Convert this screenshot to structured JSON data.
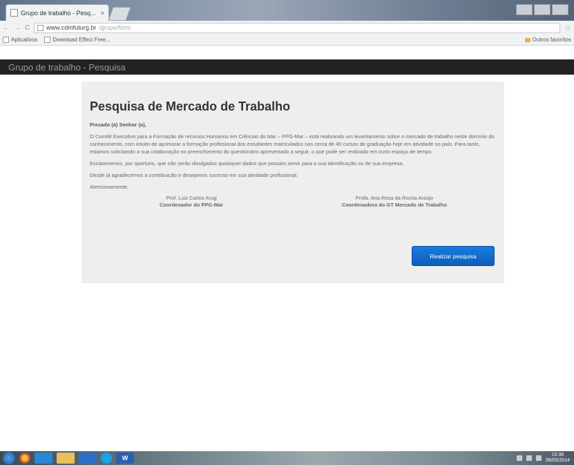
{
  "browser": {
    "tab_title": "Grupo de trabalho - Pesq...",
    "tab_close": "×",
    "url_host": "www.cdmfuturg.br",
    "url_path": "/grupo/form",
    "bookmarks": [
      "Aplicativos",
      "Download Effect Free..."
    ],
    "bookmark_right": "Outros favoritos"
  },
  "navbar": {
    "brand": "Grupo de trabalho - Pesquisa"
  },
  "main": {
    "title": "Pesquisa de Mercado de Trabalho",
    "greeting": "Prezado (a) Senhor (a),",
    "paragraph1": "O Comitê Executivo para a Formação de recursos Humanos em Ciências do Mar – PPG-Mar – está realizando um levantamento sobre o mercado de trabalho neste domínio do conhecimento, com intuito de aprimorar a formação profissional dos estudantes matriculados nos cerca de 40 cursos de graduação hoje em atividade no país. Para tanto, estamos solicitando a sua colaboração no preenchimento do questionário apresentado a seguir, o que pode ser realizado em curto espaço de tempo.",
    "paragraph2": "Esclarecemos, por oportuno, que não serão divulgados quaisquer dados que possam servir para a sua identificação ou de sua empresa.",
    "paragraph3": "Desde já agradecemos a contribuição e desejamos sucesso em sua atividade profissional.",
    "closing": "Atenciosamente,",
    "signatures": [
      {
        "name": "Prof. Luiz Carlos Krug",
        "role": "Coordenador do PPG-Mar"
      },
      {
        "name": "Profa. Ana Rosa da Rocha Araújo",
        "role": "Coordenadora do GT Mercado de Trabalho"
      }
    ],
    "button": "Realizar pesquisa"
  },
  "taskbar": {
    "word_label": "W",
    "clock_time": "15:36",
    "clock_date": "06/05/2014"
  }
}
